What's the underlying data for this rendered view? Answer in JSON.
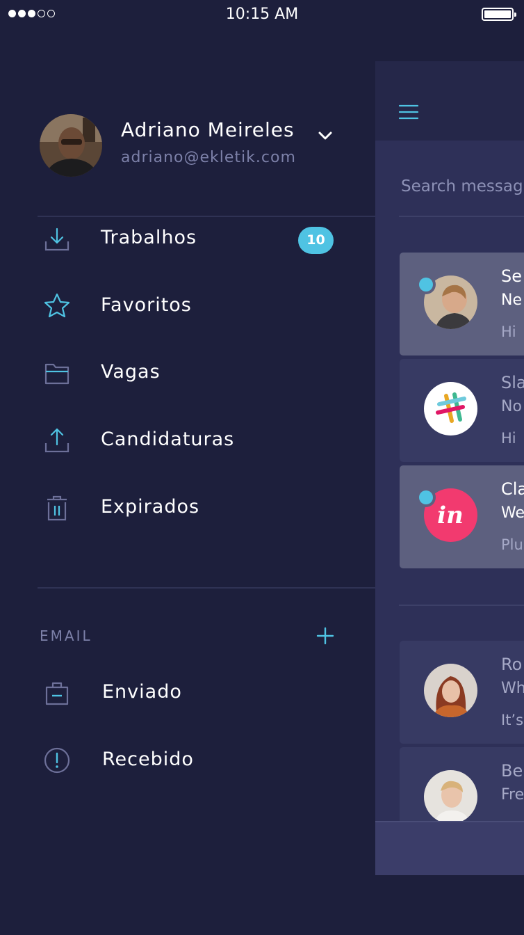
{
  "status_bar": {
    "time": "10:15 AM",
    "signal_filled": 3,
    "signal_total": 5,
    "battery_level": 1.0
  },
  "drawer": {
    "user": {
      "name": "Adriano Meireles",
      "email": "adriano@ekletik.com"
    },
    "nav": [
      {
        "label": "Trabalhos",
        "icon": "download-icon",
        "badge": "10"
      },
      {
        "label": "Favoritos",
        "icon": "star-icon"
      },
      {
        "label": "Vagas",
        "icon": "folder-icon"
      },
      {
        "label": "Candidaturas",
        "icon": "upload-icon"
      },
      {
        "label": "Expirados",
        "icon": "trash-icon"
      }
    ],
    "email_section": {
      "title": "EMAIL",
      "items": [
        {
          "label": "Enviado",
          "icon": "briefcase-icon"
        },
        {
          "label": "Recebido",
          "icon": "alert-circle-icon"
        }
      ]
    }
  },
  "main": {
    "search_placeholder": "Search messag",
    "messages": [
      {
        "sender": "Se",
        "subject": "Ne",
        "preview": "Hi",
        "unread": true,
        "avatar": "man-side-photo"
      },
      {
        "sender": "Sla",
        "subject": "No",
        "preview": "Hi",
        "unread": false,
        "avatar": "slack-logo"
      },
      {
        "sender": "Cla",
        "subject": "We",
        "preview": "Plu",
        "unread": true,
        "avatar": "invision-logo"
      },
      {
        "sender": "Ro",
        "subject": "Wh",
        "preview": "It’s",
        "unread": false,
        "avatar": "woman-red-hair-photo"
      },
      {
        "sender": "Be",
        "subject": "Fre",
        "preview": "",
        "unread": false,
        "avatar": "man-blond-photo"
      }
    ]
  },
  "colors": {
    "background": "#1d1f3c",
    "accent": "#4fc3e3",
    "muted": "#7c80a8",
    "card_unread": "#5d607f",
    "card_read": "#373a63",
    "invision": "#f23a6f"
  }
}
